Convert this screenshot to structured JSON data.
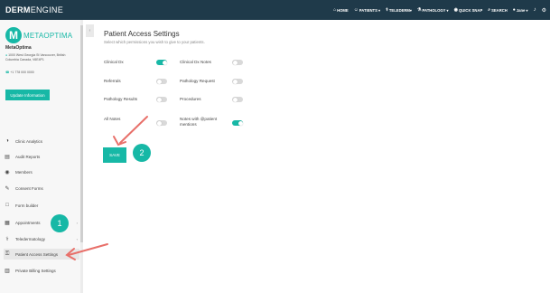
{
  "topbar": {
    "brand_bold": "DERM",
    "brand_rest": "ENGINE",
    "nav": [
      {
        "icon": "home-icon",
        "glyph": "⌂",
        "label": "HOME"
      },
      {
        "icon": "patients-icon",
        "glyph": "☺",
        "label": "PATIENTS ▾"
      },
      {
        "icon": "telederm-icon",
        "glyph": "⚕",
        "label": "TELEDERM▾"
      },
      {
        "icon": "pathology-icon",
        "glyph": "⚗",
        "label": "PATHOLOGY ▾"
      },
      {
        "icon": "camera-icon",
        "glyph": "◉",
        "label": "QUICK SNAP"
      },
      {
        "icon": "search-icon",
        "glyph": "⌕",
        "label": "SEARCH"
      },
      {
        "icon": "user-icon",
        "glyph": "●",
        "label": "Jane ▾"
      }
    ],
    "bell_glyph": "♪",
    "gear_glyph": "⚙"
  },
  "sidebar": {
    "logo_letter": "M",
    "logo_text": "METAOPTIMA",
    "org_name": "MetaOptima",
    "address_pin": "●",
    "address": "1000 West Georgia St Vancouver, British Columbia Canada, V6E4P1",
    "phone_icon": "☎",
    "phone": "+1 778 000 0000",
    "update_button": "Update Information",
    "items": [
      {
        "icon": "chart-icon",
        "glyph": "◑",
        "label": "Clinic Analytics",
        "chev": ""
      },
      {
        "icon": "report-icon",
        "glyph": "▤",
        "label": "Audit Reports",
        "chev": ""
      },
      {
        "icon": "members-icon",
        "glyph": "◉",
        "label": "Members",
        "chev": ""
      },
      {
        "icon": "consent-icon",
        "glyph": "✎",
        "label": "Consent Forms",
        "chev": ""
      },
      {
        "icon": "form-icon",
        "glyph": "□",
        "label": "Form builder",
        "chev": ""
      },
      {
        "icon": "calendar-icon",
        "glyph": "▦",
        "label": "Appointments",
        "chev": "›"
      },
      {
        "icon": "teledermatology-icon",
        "glyph": "⚕",
        "label": "Teledermatology",
        "chev": "‹"
      },
      {
        "icon": "lock-icon",
        "glyph": "⚿",
        "label": "Patient Access Settings",
        "chev": ""
      },
      {
        "icon": "billing-icon",
        "glyph": "▥",
        "label": "Private Billing Settings",
        "chev": ""
      }
    ]
  },
  "main": {
    "title": "Patient Access Settings",
    "subtitle": "Select which permissions you wish to give to your patients.",
    "permissions": [
      {
        "label": "Clinical Dx",
        "on": true
      },
      {
        "label": "Clinical Dx Notes",
        "on": false
      },
      {
        "label": "Referrals",
        "on": false
      },
      {
        "label": "Pathology Request",
        "on": false
      },
      {
        "label": "Pathology Results",
        "on": false
      },
      {
        "label": "Procedures",
        "on": false
      },
      {
        "label": "All Notes",
        "on": false
      },
      {
        "label": "Notes with @patient mentions",
        "on": true
      }
    ],
    "save_button": "SAVE"
  },
  "annotations": {
    "step1": "1",
    "step2": "2",
    "arrow_color": "#e8706a",
    "accent_color": "#17b8a6"
  }
}
